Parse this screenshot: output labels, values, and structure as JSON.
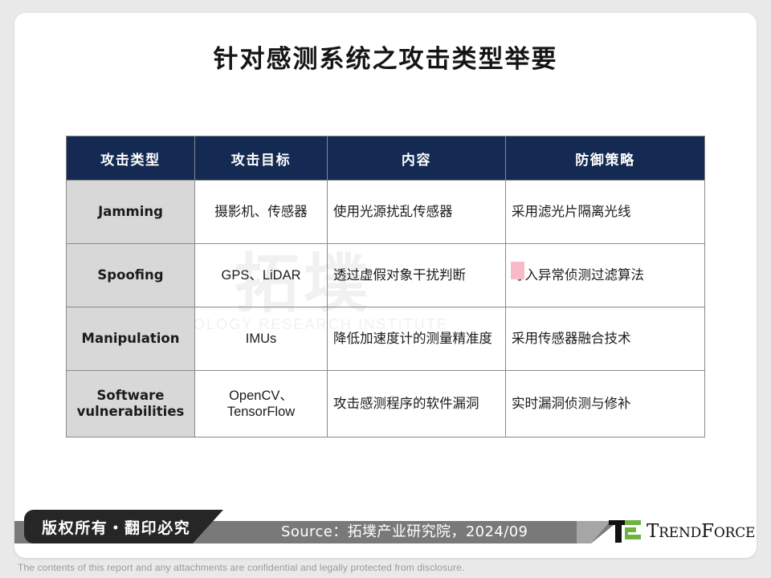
{
  "slide": {
    "title": "针对感测系统之攻击类型举要"
  },
  "watermark": {
    "cjk": "拓墣",
    "english": "TOPOLOGY RESEARCH INSTITUTE"
  },
  "table": {
    "headers": [
      "攻击类型",
      "攻击目标",
      "内容",
      "防御策略"
    ],
    "rows": [
      {
        "type": "Jamming",
        "target": "摄影机、传感器",
        "content": "使用光源扰乱传感器",
        "defense": "采用滤光片隔离光线"
      },
      {
        "type": "Spoofing",
        "target": "GPS、LiDAR",
        "content": "透过虚假对象干扰判断",
        "defense": "导入异常侦测过滤算法"
      },
      {
        "type": "Manipulation",
        "target": "IMUs",
        "content": "降低加速度计的测量精准度",
        "defense": "采用传感器融合技术"
      },
      {
        "type": "Software vulnerabilities",
        "target": "OpenCV、TensorFlow",
        "content": "攻击感测程序的软件漏洞",
        "defense": "实时漏洞侦测与修补"
      }
    ]
  },
  "footer": {
    "copyright": "版权所有・翻印必究",
    "source": "Source：拓墣产业研究院，2024/09",
    "logo_text": "TRENDFORCE",
    "logo_text_caps": "T",
    "disclaimer": "The contents of this report and any attachments are confidential and legally protected from disclosure."
  },
  "colors": {
    "header_navy": "#142a52",
    "type_cell_gray": "#d8d8d8",
    "band_gray": "#797979",
    "badge_black": "#262626",
    "logo_green": "#6cb33f",
    "page_bg": "#e9e9e9",
    "pink_artifact": "#f9b9c6"
  }
}
